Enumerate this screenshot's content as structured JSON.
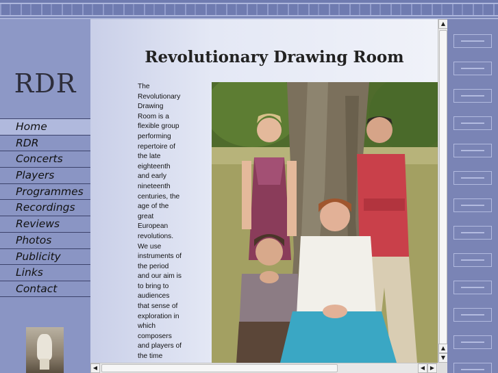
{
  "site": {
    "logo_text": "RDR",
    "page_title": "Revolutionary Drawing Room"
  },
  "nav": {
    "items": [
      {
        "label": "Home"
      },
      {
        "label": "RDR"
      },
      {
        "label": "Concerts"
      },
      {
        "label": "Players"
      },
      {
        "label": "Programmes"
      },
      {
        "label": "Recordings"
      },
      {
        "label": "Reviews"
      },
      {
        "label": "Photos"
      },
      {
        "label": "Publicity"
      },
      {
        "label": "Links"
      },
      {
        "label": "Contact"
      }
    ],
    "active_index": 0
  },
  "intro_text": "The Revolutionary Drawing Room is a flexible group performing repertoire of the late eighteenth and early nineteenth centuries, the age of the great European revolutions. We use instruments of the period and our aim is to bring to audiences that sense of exploration in which composers and players of the time",
  "scrollbars": {
    "up_glyph": "▲",
    "down_glyph": "▼",
    "left_glyph": "◀",
    "right_glyph": "▶"
  },
  "colors": {
    "frame": "#7c86b6",
    "sidebar": "#8a95c4",
    "nav_active": "#b0b9dd",
    "content_bg": "#e4e8f5"
  },
  "icons": {
    "side_thumbnail": "vase-photo-icon",
    "main_photo": "group-photo"
  }
}
